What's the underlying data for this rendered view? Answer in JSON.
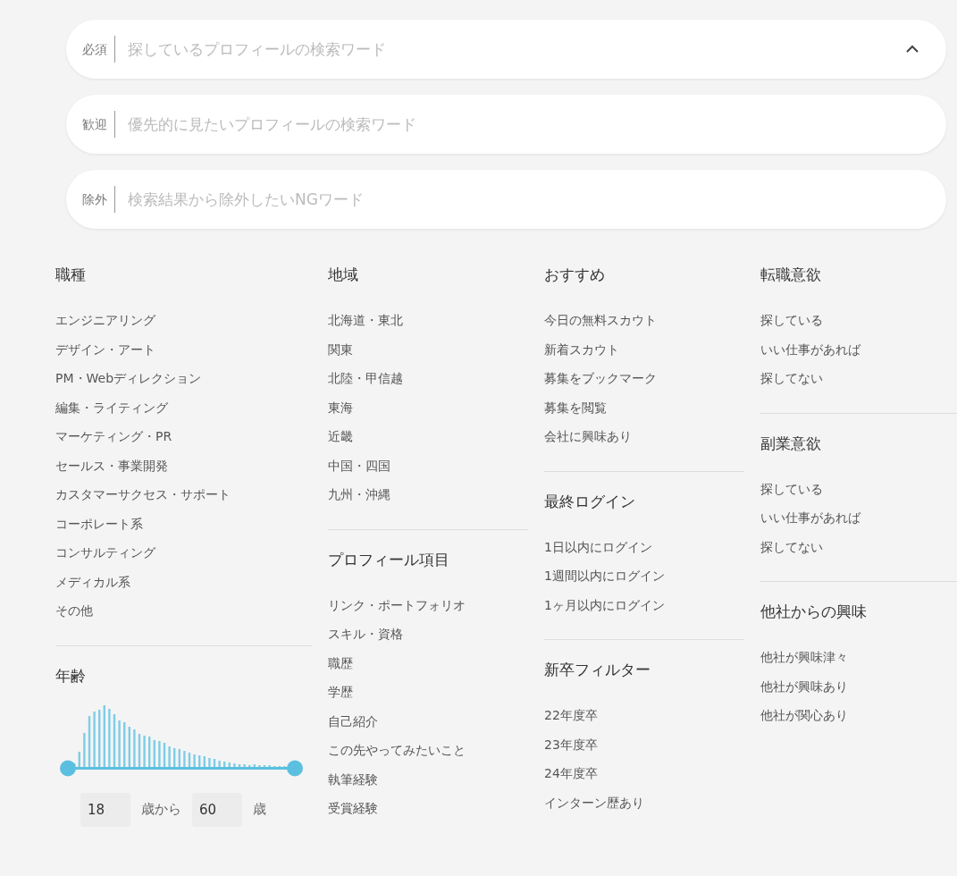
{
  "search_fields": [
    {
      "label": "必須",
      "placeholder": "探しているプロフィールの検索ワード",
      "collapse_toggle": true
    },
    {
      "label": "歓迎",
      "placeholder": "優先的に見たいプロフィールの検索ワード",
      "collapse_toggle": false
    },
    {
      "label": "除外",
      "placeholder": "検索結果から除外したいNGワード",
      "collapse_toggle": false
    }
  ],
  "columns": [
    {
      "sections": [
        {
          "kind": "list",
          "title": "職種",
          "items": [
            "エンジニアリング",
            "デザイン・アート",
            "PM・Webディレクション",
            "編集・ライティング",
            "マーケティング・PR",
            "セールス・事業開発",
            "カスタマーサクセス・サポート",
            "コーポレート系",
            "コンサルティング",
            "メディカル系",
            "その他"
          ]
        },
        {
          "kind": "age",
          "title": "年齢",
          "thumbs": [
            {
              "level": 0
            },
            {
              "level": 1
            }
          ],
          "min_value": "18",
          "from_label": "歳から",
          "max_value": "60",
          "unit_label": "歳"
        }
      ]
    },
    {
      "sections": [
        {
          "kind": "list",
          "title": "地域",
          "items": [
            "北海道・東北",
            "関東",
            "北陸・甲信越",
            "東海",
            "近畿",
            "中国・四国",
            "九州・沖縄"
          ]
        },
        {
          "kind": "list",
          "title": "プロフィール項目",
          "items": [
            "リンク・ポートフォリオ",
            "スキル・資格",
            "職歴",
            "学歴",
            "自己紹介",
            "この先やってみたいこと",
            "執筆経験",
            "受賞経験"
          ]
        }
      ]
    },
    {
      "sections": [
        {
          "kind": "list",
          "title": "おすすめ",
          "items": [
            "今日の無料スカウト",
            "新着スカウト",
            "募集をブックマーク",
            "募集を閲覧",
            "会社に興味あり"
          ]
        },
        {
          "kind": "list",
          "title": "最終ログイン",
          "items": [
            "1日以内にログイン",
            "1週間以内にログイン",
            "1ヶ月以内にログイン"
          ]
        },
        {
          "kind": "list",
          "title": "新卒フィルター",
          "items": [
            "22年度卒",
            "23年度卒",
            "24年度卒",
            "インターン歴あり"
          ]
        }
      ]
    },
    {
      "sections": [
        {
          "kind": "list",
          "title": "転職意欲",
          "items": [
            "探している",
            "いい仕事があれば",
            "探してない"
          ]
        },
        {
          "kind": "list",
          "title": "副業意欲",
          "items": [
            "探している",
            "いい仕事があれば",
            "探してない"
          ]
        },
        {
          "kind": "list",
          "title": "他社からの興味",
          "items": [
            "他社が興味津々",
            "他社が興味あり",
            "他社が関心あり"
          ]
        }
      ]
    }
  ]
}
